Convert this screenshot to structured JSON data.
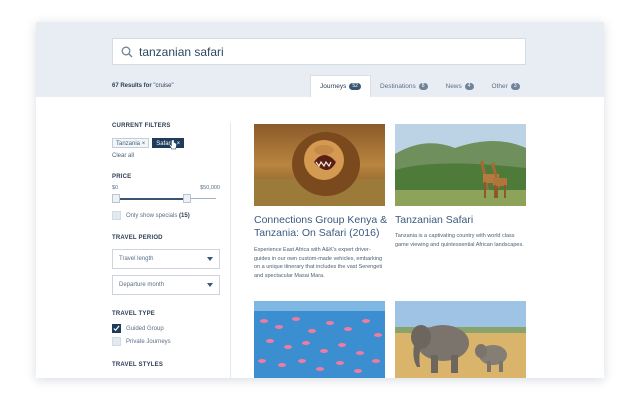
{
  "search": {
    "query": "tanzanian safari"
  },
  "results": {
    "count_text": "67 Results for",
    "query_text": "\"cruise\""
  },
  "tabs": [
    {
      "label": "Journeys",
      "count": "52",
      "active": true
    },
    {
      "label": "Destinations",
      "count": "8",
      "active": false
    },
    {
      "label": "News",
      "count": "4",
      "active": false
    },
    {
      "label": "Other",
      "count": "3",
      "active": false
    }
  ],
  "filters": {
    "current_title": "CURRENT FILTERS",
    "chips": [
      "Tanzania",
      "Safaris"
    ],
    "chip_remove": "×",
    "clear_all": "Clear all",
    "price_title": "PRICE",
    "price_min": "$0",
    "price_max": "$50,000",
    "price_fraction": 0.71,
    "specials_label": "Only show specials",
    "specials_count": "(15)",
    "period_title": "TRAVEL PERIOD",
    "travel_length": "Travel length",
    "departure_month": "Departure month",
    "type_title": "TRAVEL TYPE",
    "types": [
      {
        "label": "Guided Group",
        "checked": true
      },
      {
        "label": "Private Journeys",
        "checked": false
      }
    ],
    "styles_title": "TRAVEL STYLES"
  },
  "cards": [
    {
      "title": "Connections Group Kenya & Tanzania: On Safari (2016)",
      "desc": "Experience East Africa with A&K's expert driver-guides in our own custom-made vehicles, embarking on a unique itinerary that includes the vast Serengeti and spectacular Masai Mara.",
      "image": "lion-image"
    },
    {
      "title": "Tanzanian Safari",
      "desc": "Tanzania is a captivating country with world class game viewing and quintessential African landscapes.",
      "image": "giraffe-image"
    },
    {
      "image": "flamingo-image"
    },
    {
      "image": "elephant-image"
    }
  ],
  "colors": {
    "accent": "#1f3b5c",
    "header": "#e8edf3",
    "title": "#3a5b80"
  }
}
